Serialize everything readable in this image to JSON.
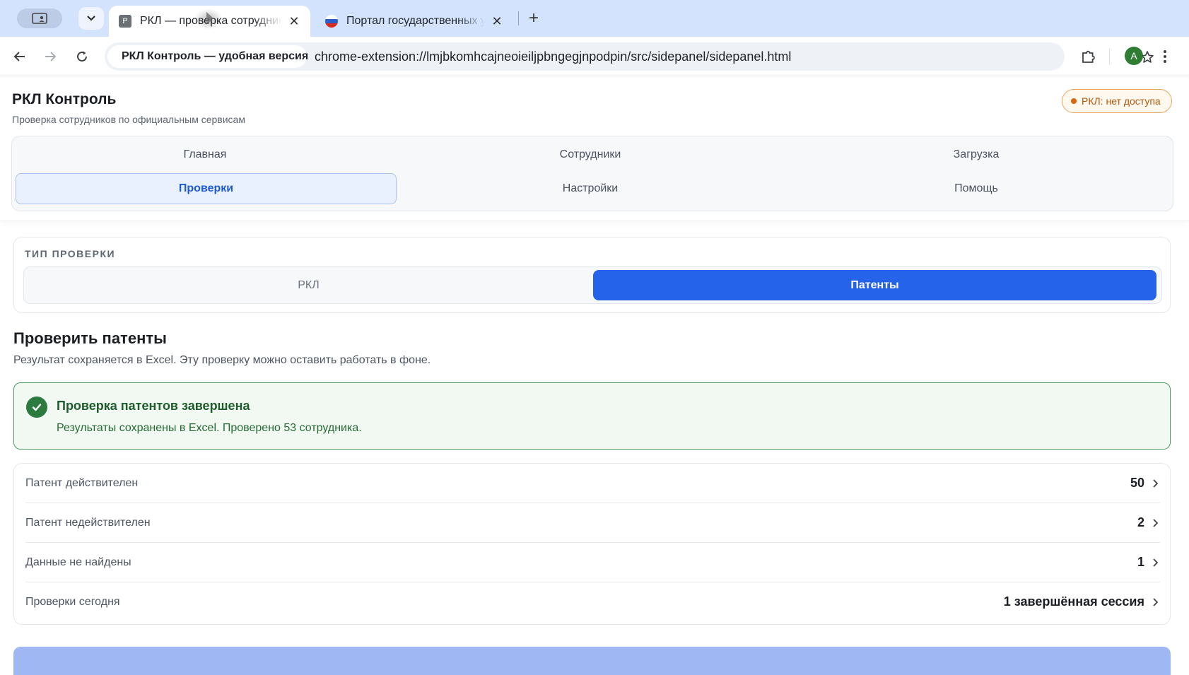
{
  "browser": {
    "tabs": [
      {
        "favicon_letter": "Р",
        "title": "РКЛ — проверка сотрудников",
        "active": true
      },
      {
        "title": "Портал государственных услуг",
        "active": false
      }
    ],
    "site_chip": "РКЛ Контроль — удобная версия",
    "url": "chrome-extension://lmjbkomhcajneoieiljpbngegjnpodpin/src/sidepanel/sidepanel.html",
    "avatar_letter": "A"
  },
  "app": {
    "title": "РКЛ Контроль",
    "subtitle": "Проверка сотрудников по официальным сервисам",
    "status": "РКЛ: нет доступа",
    "nav": [
      {
        "label": "Главная"
      },
      {
        "label": "Сотрудники"
      },
      {
        "label": "Загрузка"
      },
      {
        "label": "Проверки",
        "active": true
      },
      {
        "label": "Настройки"
      },
      {
        "label": "Помощь"
      }
    ]
  },
  "check_type": {
    "label": "ТИП ПРОВЕРКИ",
    "options": [
      "РКЛ",
      "Патенты"
    ],
    "selected": "Патенты"
  },
  "section": {
    "title": "Проверить патенты",
    "subtitle": "Результат сохраняется в Excel. Эту проверку можно оставить работать в фоне."
  },
  "alert": {
    "title": "Проверка патентов завершена",
    "body": "Результаты сохранены в Excel. Проверено 53 сотрудника."
  },
  "stats": [
    {
      "label": "Патент действителен",
      "value": "50"
    },
    {
      "label": "Патент недействителен",
      "value": "2"
    },
    {
      "label": "Данные не найдены",
      "value": "1"
    },
    {
      "label": "Проверки сегодня",
      "value": "1 завершённая сессия"
    }
  ],
  "colors": {
    "accent": "#2563eb",
    "success": "#2c7a3d",
    "warning": "#d9650c"
  }
}
